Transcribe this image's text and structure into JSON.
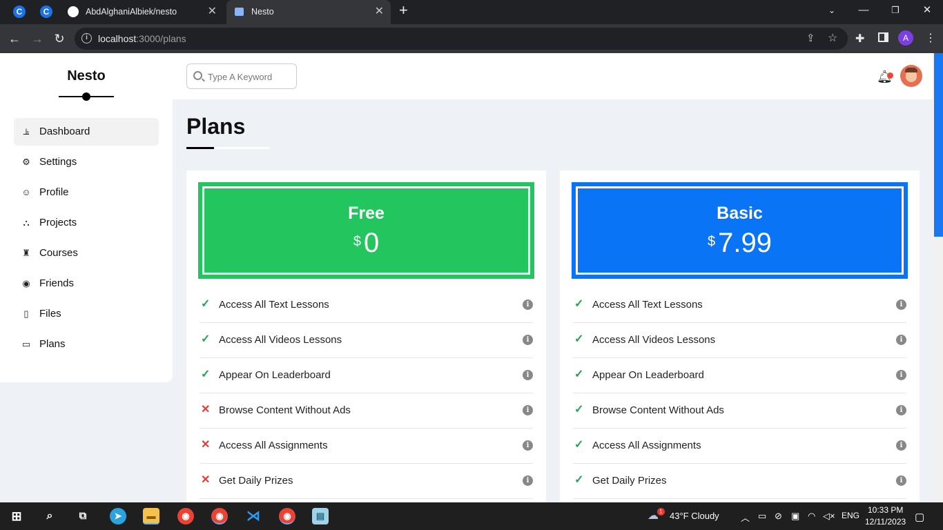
{
  "browser": {
    "tabs": [
      {
        "label": "AbdAlghaniAlbiek/nesto"
      },
      {
        "label": "Nesto"
      }
    ],
    "new_tab": "+",
    "url_host": "localhost",
    "url_path": ":3000/plans"
  },
  "sidebar": {
    "brand": "Nesto",
    "items": [
      {
        "label": "Dashboard",
        "icon": "chart-icon"
      },
      {
        "label": "Settings",
        "icon": "gear-icon"
      },
      {
        "label": "Profile",
        "icon": "user-icon"
      },
      {
        "label": "Projects",
        "icon": "diagram-icon"
      },
      {
        "label": "Courses",
        "icon": "graduation-cap-icon"
      },
      {
        "label": "Friends",
        "icon": "user-circle-icon"
      },
      {
        "label": "Files",
        "icon": "file-icon"
      },
      {
        "label": "Plans",
        "icon": "credit-card-icon"
      }
    ]
  },
  "header": {
    "search_placeholder": "Type A Keyword"
  },
  "page": {
    "title": "Plans"
  },
  "plans": [
    {
      "name": "Free",
      "currency": "$",
      "price": "0",
      "color": "#22c55e",
      "features": [
        {
          "label": "Access All Text Lessons",
          "included": true
        },
        {
          "label": "Access All Videos Lessons",
          "included": true
        },
        {
          "label": "Appear On Leaderboard",
          "included": true
        },
        {
          "label": "Browse Content Without Ads",
          "included": false
        },
        {
          "label": "Access All Assignments",
          "included": false
        },
        {
          "label": "Get Daily Prizes",
          "included": false
        }
      ]
    },
    {
      "name": "Basic",
      "currency": "$",
      "price": "7.99",
      "color": "#0a74f6",
      "features": [
        {
          "label": "Access All Text Lessons",
          "included": true
        },
        {
          "label": "Access All Videos Lessons",
          "included": true
        },
        {
          "label": "Appear On Leaderboard",
          "included": true
        },
        {
          "label": "Browse Content Without Ads",
          "included": true
        },
        {
          "label": "Access All Assignments",
          "included": true
        },
        {
          "label": "Get Daily Prizes",
          "included": true
        }
      ]
    }
  ],
  "taskbar": {
    "weather": "43°F  Cloudy",
    "weather_badge": "1",
    "language": "ENG",
    "time": "10:33 PM",
    "date": "12/11/2023"
  }
}
